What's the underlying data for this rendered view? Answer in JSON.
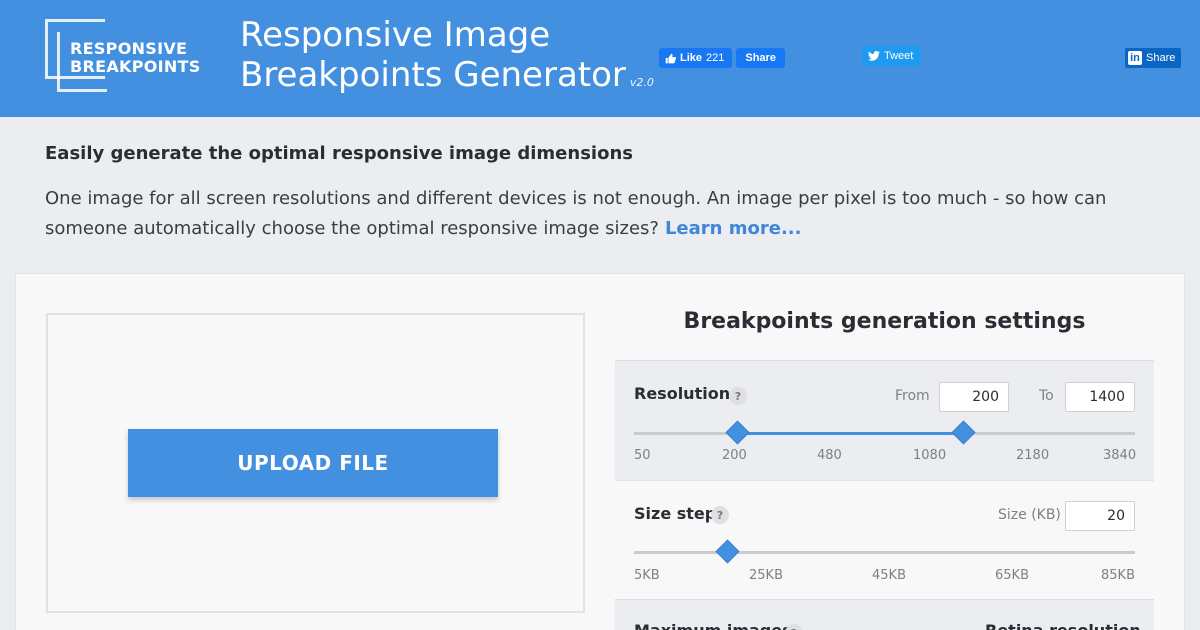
{
  "header": {
    "logo_line1": "RESPONSIVE",
    "logo_line2": "BREAKPOINTS",
    "title_line1": "Responsive Image",
    "title_line2": "Breakpoints Generator",
    "version": "v2.0",
    "color": "#4490e0"
  },
  "social": {
    "fb_like_label": "Like",
    "fb_like_count": "221",
    "fb_share_label": "Share",
    "tweet_label": "Tweet",
    "linkedin_share_label": "Share"
  },
  "intro": {
    "heading": "Easily generate the optimal responsive image dimensions",
    "text": "One image for all screen resolutions and different devices is not enough. An image per pixel is too much - so how can someone automatically choose the optimal responsive image sizes?",
    "learn_more": "Learn more..."
  },
  "upload": {
    "button_label": "UPLOAD FILE"
  },
  "settings": {
    "title": "Breakpoints generation settings",
    "resolution": {
      "label": "Resolution",
      "help": "?",
      "from_label": "From",
      "from_value": "200",
      "to_label": "To",
      "to_value": "1400",
      "ticks": [
        "50",
        "200",
        "480",
        "1080",
        "2180",
        "3840"
      ]
    },
    "size_step": {
      "label": "Size step",
      "help": "?",
      "size_label": "Size (KB)",
      "size_value": "20",
      "ticks": [
        "5KB",
        "25KB",
        "45KB",
        "65KB",
        "85KB"
      ]
    },
    "max_images": {
      "label": "Maximum images",
      "help": "?",
      "retina_label": "Retina resolution"
    }
  }
}
